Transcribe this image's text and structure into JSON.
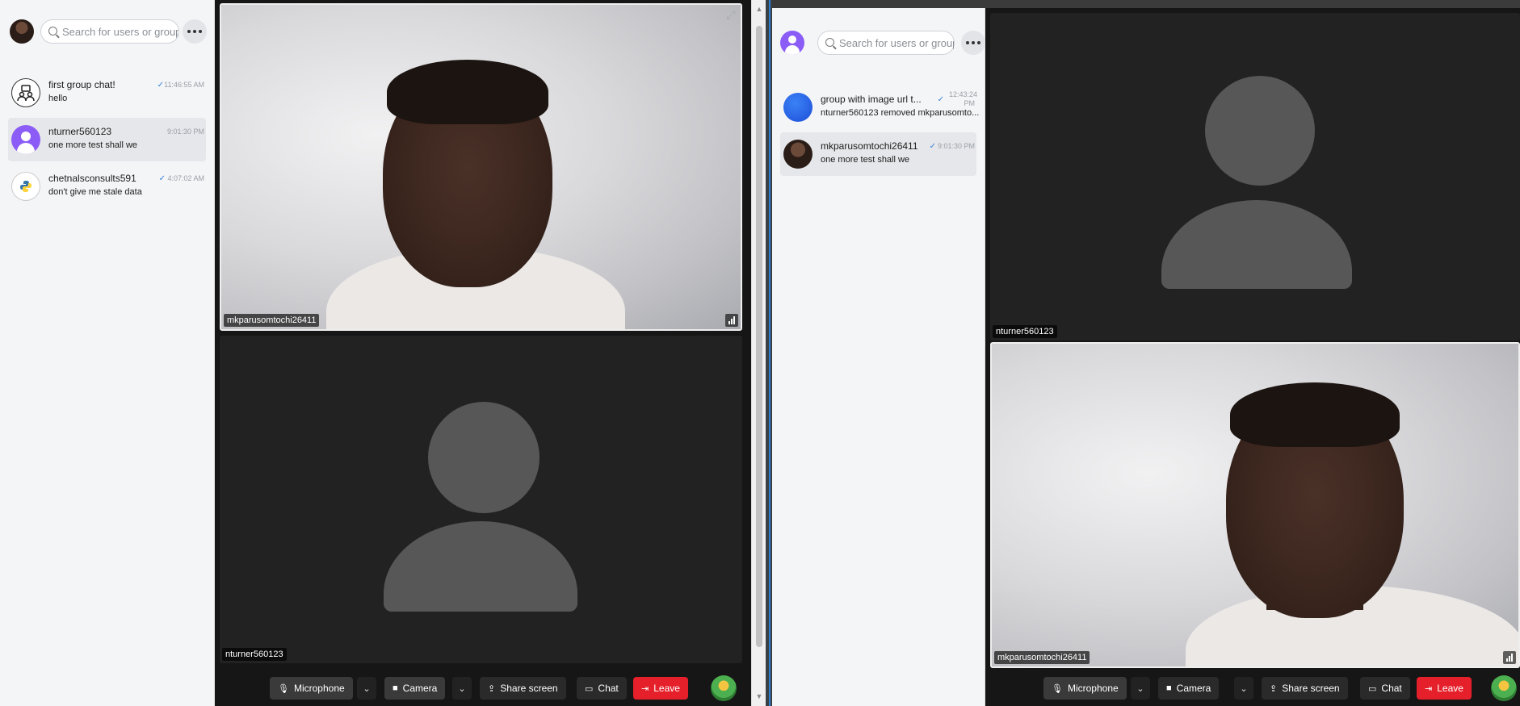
{
  "left": {
    "search": {
      "placeholder": "Search for users or groups"
    },
    "conversations": [
      {
        "name": "first group chat!",
        "message": "hello",
        "time": "11:46:55 AM",
        "avatar": "group-icon",
        "active": false
      },
      {
        "name": "nturner560123",
        "message": "one more test shall we",
        "time": "9:01:30 PM",
        "avatar": "user-placeholder",
        "active": true
      },
      {
        "name": "chetnalsconsults591",
        "message": "don't give me stale data",
        "time": "4:07:02 AM",
        "avatar": "python-logo",
        "active": false
      }
    ],
    "tiles": [
      {
        "participant": "mkparusomtochi26411",
        "kind": "video"
      },
      {
        "participant": "nturner560123",
        "kind": "placeholder"
      }
    ],
    "toolbar": {
      "microphone": "Microphone",
      "camera": "Camera",
      "share": "Share screen",
      "chat": "Chat",
      "leave": "Leave"
    }
  },
  "right": {
    "search": {
      "placeholder": "Search for users or groups"
    },
    "conversations": [
      {
        "name": "group with image url t...",
        "message": "nturner560123 removed mkparusomto...",
        "time": "12:43:24 PM",
        "avatar": "blue-circle",
        "active": false
      },
      {
        "name": "mkparusomtochi26411",
        "message": "one more test shall we",
        "time": "9:01:30 PM",
        "avatar": "user-photo",
        "active": true
      }
    ],
    "tiles": [
      {
        "participant": "nturner560123",
        "kind": "placeholder"
      },
      {
        "participant": "mkparusomtochi26411",
        "kind": "video"
      }
    ],
    "toolbar": {
      "microphone": "Microphone",
      "camera": "Camera",
      "share": "Share screen",
      "chat": "Chat",
      "leave": "Leave"
    }
  },
  "colors": {
    "accent": "#3b82d6",
    "leave": "#e5202b",
    "placeholder": "#575757",
    "tile_bg": "#222222"
  }
}
